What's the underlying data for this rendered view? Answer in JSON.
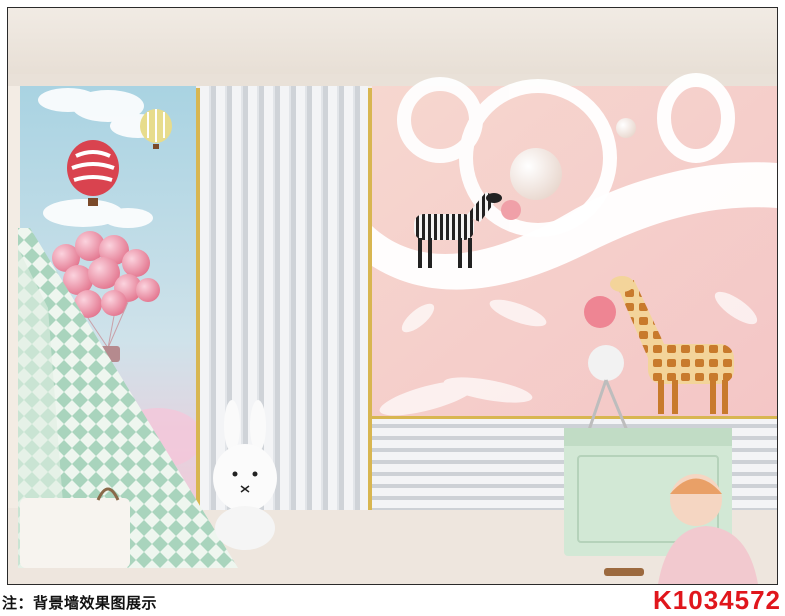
{
  "image": {
    "subject": "children room wall mural mockup",
    "scene_elements": [
      "hot-air-balloon",
      "pink-balloons",
      "white-stripe-panel",
      "pink-wall-panel",
      "zebra",
      "giraffe",
      "bunny-lamp",
      "teepee-tent",
      "toy-chest",
      "child"
    ],
    "colors": {
      "sky": "#b9dbe5",
      "pink_wall": "#f6cfcd",
      "stripe_panel": "#eceef0",
      "gold_trim": "#d8b651",
      "chest": "#d2e8d5",
      "code_red": "#e0161c"
    }
  },
  "caption": {
    "note": "注：背景墙效果图展示"
  },
  "product": {
    "code": "K1034572"
  }
}
